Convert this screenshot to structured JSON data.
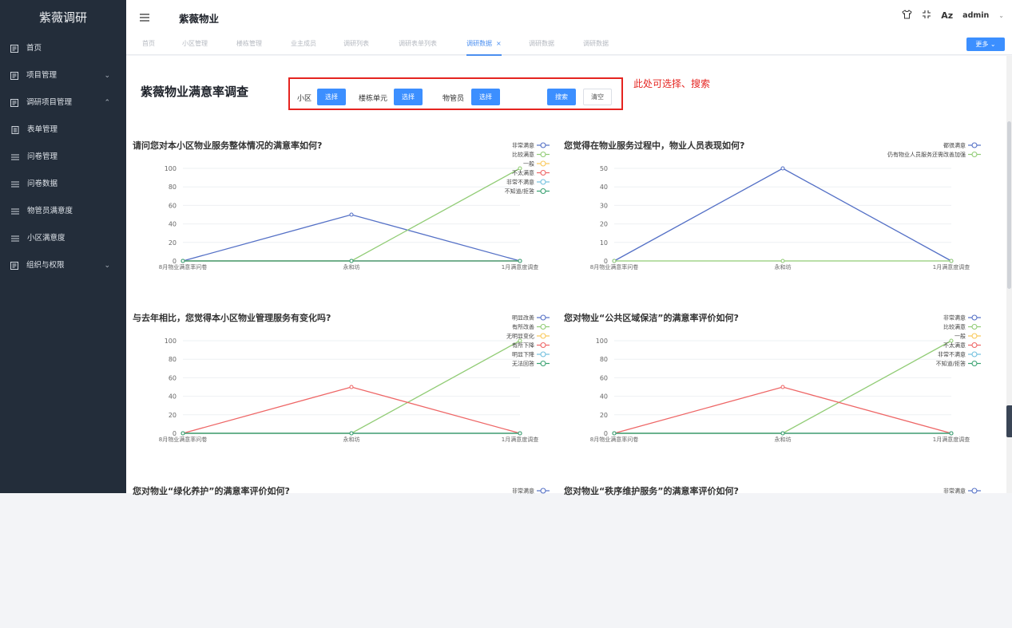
{
  "sidebar": {
    "title": "紫薇调研",
    "items": [
      {
        "label": "首页",
        "icon": "dashboard-icon",
        "chevron": ""
      },
      {
        "label": "项目管理",
        "icon": "dashboard-icon",
        "chevron": "⌄"
      },
      {
        "label": "调研项目管理",
        "icon": "dashboard-icon",
        "chevron": "⌃"
      },
      {
        "label": "表单管理",
        "icon": "form-icon",
        "chevron": "",
        "sub": true
      },
      {
        "label": "问卷管理",
        "icon": "list-icon",
        "chevron": "",
        "sub": true
      },
      {
        "label": "问卷数据",
        "icon": "list-icon",
        "chevron": "",
        "sub": true
      },
      {
        "label": "物管员满意度",
        "icon": "list-icon",
        "chevron": "",
        "sub": true
      },
      {
        "label": "小区满意度",
        "icon": "list-icon",
        "chevron": "",
        "sub": true
      },
      {
        "label": "组织与权限",
        "icon": "dashboard-icon",
        "chevron": "⌄"
      }
    ]
  },
  "header": {
    "title": "紫薇物业",
    "font_icon_text": "Aᴢ",
    "user": "admin"
  },
  "tabs": [
    {
      "label": "首页",
      "closable": false,
      "active": false
    },
    {
      "label": "小区管理",
      "closable": false,
      "active": false
    },
    {
      "label": "楼栋管理",
      "closable": false,
      "active": false
    },
    {
      "label": "业主成员",
      "closable": false,
      "active": false
    },
    {
      "label": "调研列表",
      "closable": false,
      "active": false
    },
    {
      "label": "调研表单列表",
      "closable": false,
      "active": false
    },
    {
      "label": "调研数据",
      "closable": true,
      "active": true
    },
    {
      "label": "调研数据",
      "closable": false,
      "active": false
    },
    {
      "label": "调研数据",
      "closable": false,
      "active": false
    }
  ],
  "more_label": "更多",
  "page": {
    "title": "紫薇物业满意率调查",
    "annotation": "此处可选择、搜索"
  },
  "filters": {
    "community_label": "小区",
    "building_label": "楼栋单元",
    "manager_label": "物管员",
    "select_label": "选择",
    "search_label": "搜索",
    "clear_label": "清空"
  },
  "colors": {
    "blue": "#5470c6",
    "green": "#91cc75",
    "yellow": "#fac858",
    "red": "#ee6666",
    "cyan": "#73c0de",
    "teal": "#3ba272",
    "accent": "#3c8fff",
    "annotation": "#e52420"
  },
  "chart_data": [
    {
      "type": "line",
      "title": "请问您对本小区物业服务整体情况的满意率如何?",
      "x": [
        "8月物业满意率问卷",
        "永和坊",
        "1月满意度调查"
      ],
      "ylim": [
        0,
        100
      ],
      "yticks": [
        0,
        20,
        40,
        60,
        80,
        100
      ],
      "legend_position": "top-right",
      "series": [
        {
          "name": "非常满意",
          "values": [
            0,
            50,
            0
          ]
        },
        {
          "name": "比较满意",
          "values": [
            0,
            0,
            100
          ]
        },
        {
          "name": "一般",
          "values": [
            0,
            0,
            0
          ]
        },
        {
          "name": "不太满意",
          "values": [
            0,
            0,
            0
          ]
        },
        {
          "name": "非常不满意",
          "values": [
            0,
            0,
            0
          ]
        },
        {
          "name": "不知道/拒答",
          "values": [
            0,
            0,
            0
          ]
        }
      ]
    },
    {
      "type": "line",
      "title": "您觉得在物业服务过程中，物业人员表现如何?",
      "x": [
        "8月物业满意率问卷",
        "永和坊",
        "1月满意度调查"
      ],
      "ylim": [
        0,
        50
      ],
      "yticks": [
        0,
        10,
        20,
        30,
        40,
        50
      ],
      "legend_position": "top-right",
      "series": [
        {
          "name": "都很满意",
          "values": [
            0,
            50,
            0
          ]
        },
        {
          "name": "仍有物业人员服务还需改善加强",
          "values": [
            0,
            0,
            0
          ]
        }
      ]
    },
    {
      "type": "line",
      "title": "与去年相比，您觉得本小区物业管理服务有变化吗?",
      "x": [
        "8月物业满意率问卷",
        "永和坊",
        "1月满意度调查"
      ],
      "ylim": [
        0,
        100
      ],
      "yticks": [
        0,
        20,
        40,
        60,
        80,
        100
      ],
      "legend_position": "top-right",
      "series": [
        {
          "name": "明显改善",
          "values": [
            0,
            0,
            0
          ]
        },
        {
          "name": "有所改善",
          "values": [
            0,
            0,
            100
          ]
        },
        {
          "name": "无明显变化",
          "values": [
            0,
            0,
            0
          ]
        },
        {
          "name": "有所下降",
          "values": [
            0,
            50,
            0
          ]
        },
        {
          "name": "明显下降",
          "values": [
            0,
            0,
            0
          ]
        },
        {
          "name": "无法回答",
          "values": [
            0,
            0,
            0
          ]
        }
      ]
    },
    {
      "type": "line",
      "title": "您对物业“公共区域保洁”的满意率评价如何?",
      "x": [
        "8月物业满意率问卷",
        "永和坊",
        "1月满意度调查"
      ],
      "ylim": [
        0,
        100
      ],
      "yticks": [
        0,
        20,
        40,
        60,
        80,
        100
      ],
      "legend_position": "top-right",
      "series": [
        {
          "name": "非常满意",
          "values": [
            0,
            0,
            0
          ]
        },
        {
          "name": "比较满意",
          "values": [
            0,
            0,
            100
          ]
        },
        {
          "name": "一般",
          "values": [
            0,
            0,
            0
          ]
        },
        {
          "name": "不太满意",
          "values": [
            0,
            50,
            0
          ]
        },
        {
          "name": "非常不满意",
          "values": [
            0,
            0,
            0
          ]
        },
        {
          "name": "不知道/拒答",
          "values": [
            0,
            0,
            0
          ]
        }
      ]
    },
    {
      "type": "line",
      "title": "您对物业“绿化养护”的满意率评价如何?",
      "x": [],
      "ylim": [
        0,
        100
      ],
      "yticks": [],
      "legend_position": "top-right",
      "series": [
        {
          "name": "非常满意",
          "values": []
        }
      ]
    },
    {
      "type": "line",
      "title": "您对物业“秩序维护服务”的满意率评价如何?",
      "x": [],
      "ylim": [
        0,
        100
      ],
      "yticks": [],
      "legend_position": "top-right",
      "series": [
        {
          "name": "非常满意",
          "values": []
        }
      ]
    }
  ]
}
